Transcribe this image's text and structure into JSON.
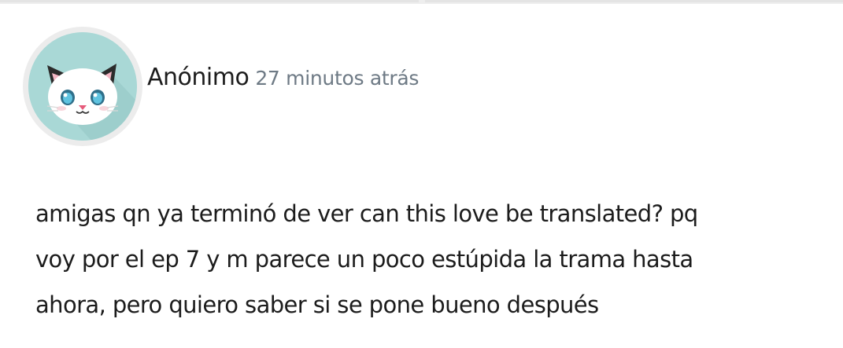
{
  "comment": {
    "author": "Anónimo",
    "time": "27 minutos atrás",
    "avatar_icon": "white-cat-icon",
    "text_lines": [
      "amigas qn ya terminó de ver can this love be translated? pq",
      "voy por el ep 7 y m parece un poco estúpida la trama hasta",
      "ahora, pero quiero saber si se pone bueno después"
    ]
  },
  "colors": {
    "avatar_bg": "#a9d8d6",
    "time_text": "#6e7a85",
    "body_text": "#1c1c1c"
  }
}
